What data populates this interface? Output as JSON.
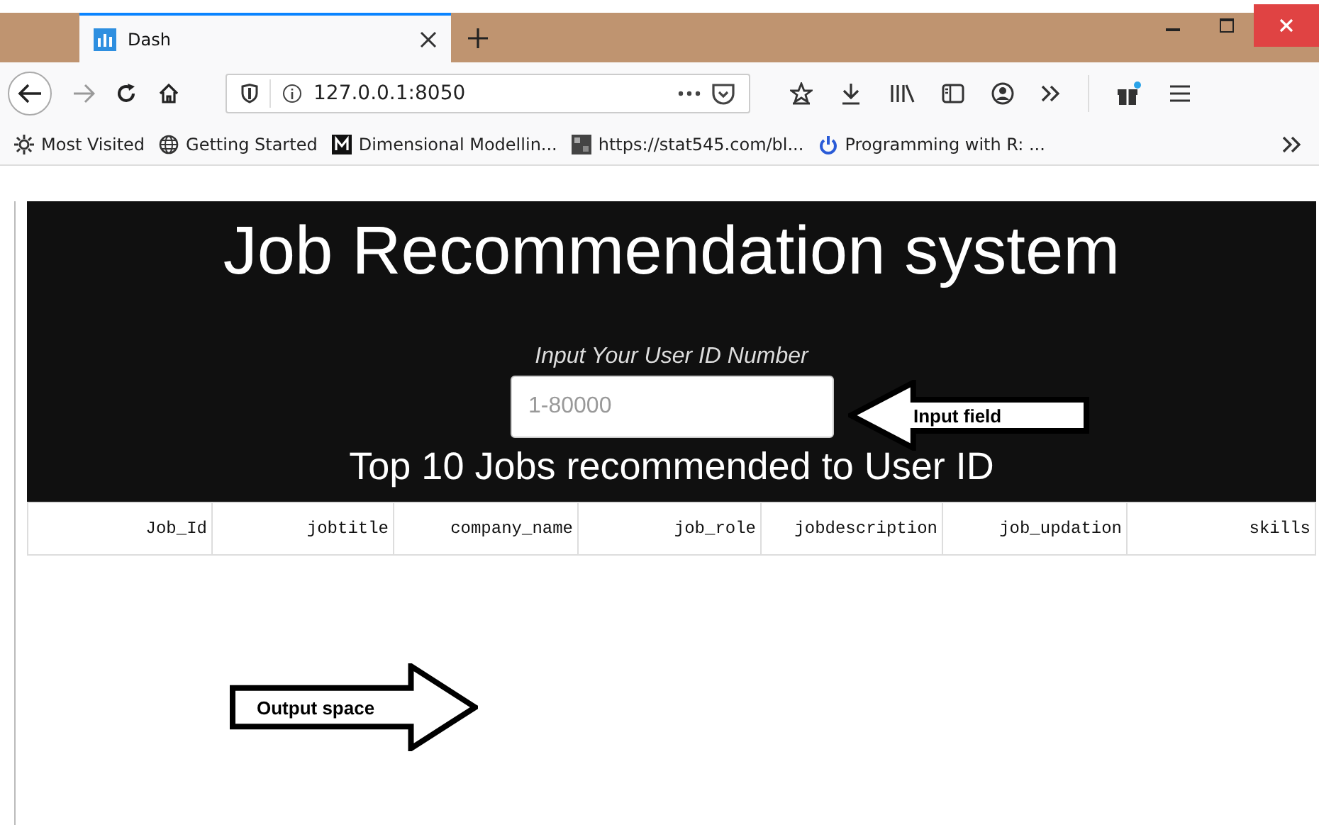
{
  "browser": {
    "tabs": [
      {
        "title": "Dash",
        "selected": true
      }
    ],
    "url": "127.0.0.1:8050",
    "bookmarks": [
      {
        "label": "Most Visited",
        "kind": "gear"
      },
      {
        "label": "Getting Started",
        "kind": "globe"
      },
      {
        "label": "Dimensional Modellin...",
        "kind": "m"
      },
      {
        "label": "https://stat545.com/bl...",
        "kind": "stat"
      },
      {
        "label": "Programming with R: ...",
        "kind": "power"
      }
    ]
  },
  "page": {
    "title": "Job Recommendation system",
    "input_label": "Input Your User ID Number",
    "input": {
      "placeholder": "1-80000"
    },
    "subtitle": "Top 10 Jobs recommended to User ID",
    "table": {
      "columns": [
        "Job_Id",
        "jobtitle",
        "company_name",
        "job_role",
        "jobdescription",
        "job_updation",
        "skills"
      ]
    }
  },
  "annotations": [
    {
      "text": "Input field",
      "kind": "left"
    },
    {
      "text": "Output space",
      "kind": "right"
    }
  ]
}
